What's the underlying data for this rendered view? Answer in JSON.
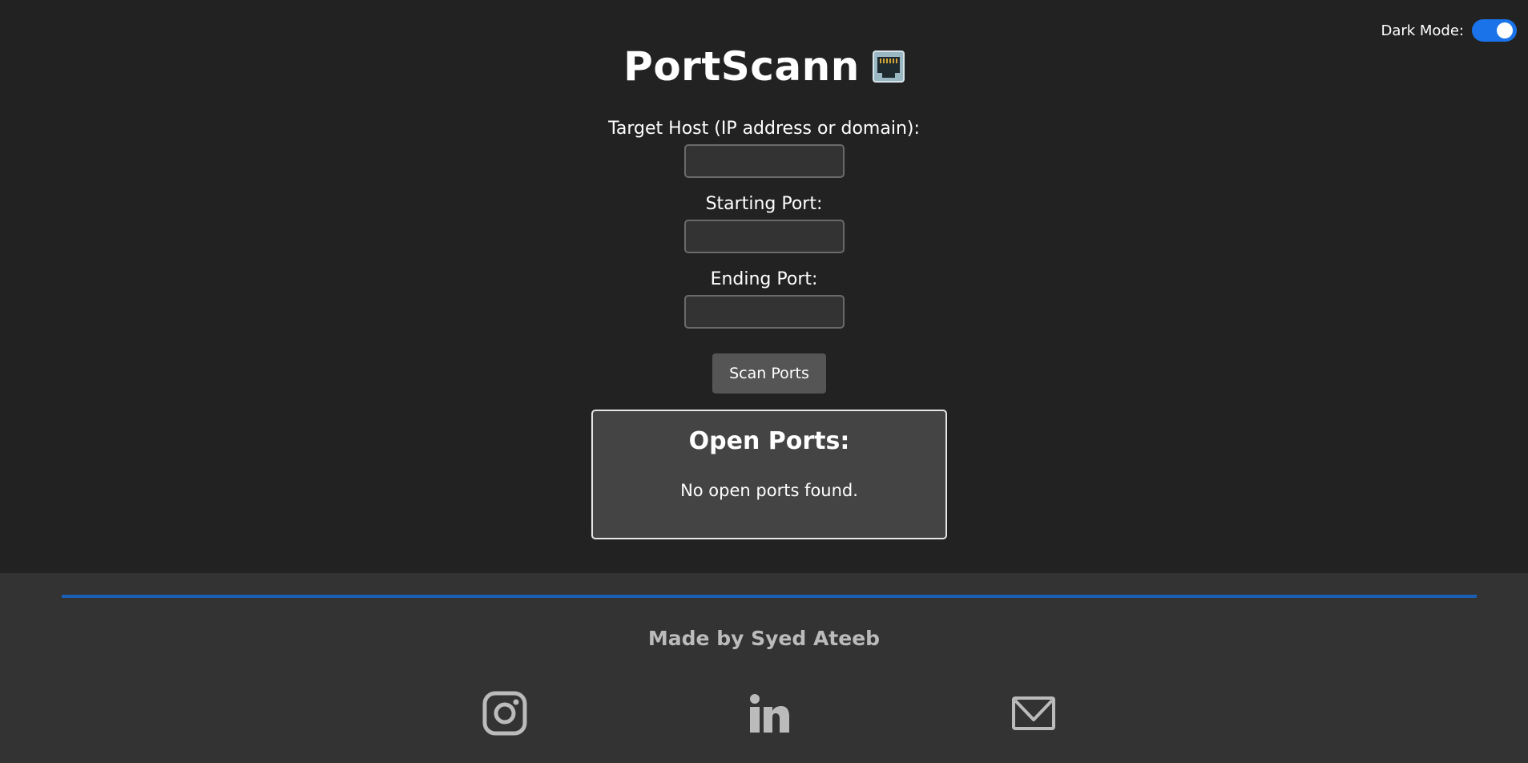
{
  "header": {
    "title": "PortScann",
    "title_icon": "ethernet-port-icon"
  },
  "dark_mode": {
    "label": "Dark Mode:",
    "enabled": true,
    "accent_color": "#1a73e8"
  },
  "form": {
    "target_host": {
      "label": "Target Host (IP address or domain):",
      "value": ""
    },
    "starting_port": {
      "label": "Starting Port:",
      "value": ""
    },
    "ending_port": {
      "label": "Ending Port:",
      "value": ""
    },
    "scan_button_label": "Scan Ports"
  },
  "results": {
    "title": "Open Ports:",
    "message": "No open ports found."
  },
  "footer": {
    "credit": "Made by Syed Ateeb",
    "divider_color": "#1a5fb4",
    "social_links": [
      {
        "icon": "instagram-icon"
      },
      {
        "icon": "linkedin-icon"
      },
      {
        "icon": "mail-icon"
      }
    ]
  },
  "colors": {
    "background": "#222222",
    "footer_background": "#333333",
    "results_background": "#444444",
    "button_background": "#555555"
  }
}
